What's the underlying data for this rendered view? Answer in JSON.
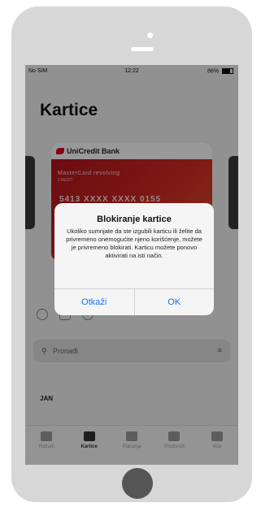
{
  "status_bar": {
    "carrier": "No SIM",
    "time": "12:22",
    "battery": "86%"
  },
  "page": {
    "title": "Kartice"
  },
  "card": {
    "bank": "UniCredit Bank",
    "name": "MasterCard revolving",
    "type": "CREDIT",
    "number": "5413 XXXX XXXX 0155"
  },
  "search": {
    "placeholder": "Pronađi"
  },
  "list": {
    "month": "JAN"
  },
  "tabs": [
    {
      "label": "Računi"
    },
    {
      "label": "Kartice"
    },
    {
      "label": "Plaćanja"
    },
    {
      "label": "Proizvodi"
    },
    {
      "label": "Više"
    }
  ],
  "alert": {
    "title": "Blokiranje kartice",
    "message": "Ukoliko sumnjate da ste izgubili karticu ili želite da privremeno onemogućite njeno korišćenje, možete je privremeno blokirati. Karticu možete ponovo aktivirati na isti način.",
    "cancel": "Otkaži",
    "ok": "OK"
  }
}
